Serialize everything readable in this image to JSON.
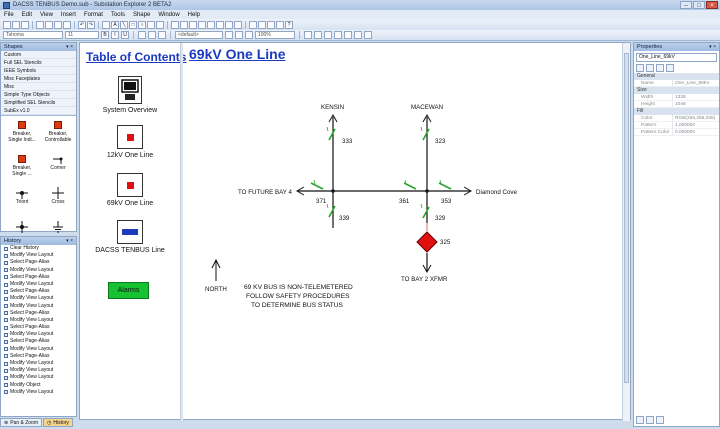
{
  "window": {
    "title": "DACSS TENBUS Demo.sub - Substation Explorer 2 BETA2"
  },
  "menu": [
    "File",
    "Edit",
    "View",
    "Insert",
    "Format",
    "Tools",
    "Shape",
    "Window",
    "Help"
  ],
  "toolbar": {
    "font": "Tahoma",
    "size": "11",
    "style_combo": "<default>",
    "zoom": "100%"
  },
  "shapes_panel": {
    "title": "Shapes",
    "stencils": [
      "Custom",
      "Full SEL Stencils",
      "IEEE Symbols",
      "Misc Faceplates",
      "Misc",
      "Simple Type Objects",
      "Simplified SEL Stencils",
      "SubEx v1.0"
    ],
    "shapes": [
      {
        "label": "Breaker, Single Indi...",
        "icon": "red-square-icon"
      },
      {
        "label": "Breaker, Controllable",
        "icon": "red-square-icon"
      },
      {
        "label": "Breaker, Single ...",
        "icon": "red-square-icon"
      },
      {
        "label": "Corner",
        "icon": "corner-icon"
      },
      {
        "label": "Triont",
        "icon": "node-icon"
      },
      {
        "label": "Cross",
        "icon": "cross-icon"
      },
      {
        "label": "",
        "icon": "node-icon"
      },
      {
        "label": "",
        "icon": "ground-icon"
      }
    ]
  },
  "history_panel": {
    "title": "History",
    "items": [
      "Clear History",
      "Modify View Layout",
      "Select Page-Alias",
      "Modify View Layout",
      "Select Page-Alias",
      "Modify View Layout",
      "Select Page-Alias",
      "Modify View Layout",
      "Modify View Layout",
      "Select Page-Alias",
      "Modify View Layout",
      "Select Page-Alias",
      "Modify View Layout",
      "Select Page-Alias",
      "Modify View Layout",
      "Select Page-Alias",
      "Modify View Layout",
      "Modify View Layout",
      "Modify View Layout",
      "Modify Object",
      "Modify View Layout"
    ]
  },
  "bottom_tabs": [
    "Pan & Zoom",
    "History"
  ],
  "nav": {
    "toc_title": "Table of Contents",
    "items": [
      "System Overview",
      "12kV One Line",
      "69kV One Line",
      "DACSS TENBUS Line"
    ],
    "alarms_label": "Alarms"
  },
  "diagram": {
    "title": "69kV One Line",
    "labels": {
      "kensin": "KENSIN",
      "macewan": "MACEWAN",
      "future_bay": "TO FUTURE BAY 4",
      "diamond_cove": "Diamond Cove",
      "bay2": "TO BAY 2 XFMR",
      "north": "NORTH"
    },
    "devices": [
      "333",
      "323",
      "371",
      "361",
      "353",
      "339",
      "329",
      "325"
    ],
    "note": [
      "69 KV BUS IS NON-TELEMETERED",
      "FOLLOW SAFETY PROCEDURES",
      "TO DETERMINE BUS STATUS"
    ],
    "colors": {
      "switch_green": "#2aa52a",
      "breaker_red": "#e01010",
      "link_blue": "#1a3ac0"
    }
  },
  "properties_panel": {
    "title": "Properties",
    "object": "One_Line_69kV",
    "categories": [
      {
        "name": "General",
        "rows": [
          {
            "key": "Name",
            "value": "One_Line_69kV"
          }
        ]
      },
      {
        "name": "Size",
        "rows": [
          {
            "key": "Width",
            "value": "1328"
          },
          {
            "key": "Height",
            "value": "1048"
          }
        ]
      },
      {
        "name": "Fill",
        "rows": [
          {
            "key": "Color",
            "value": "RGB(255,255,255)"
          },
          {
            "key": "Pattern",
            "value": "1.000000"
          },
          {
            "key": "Pattern Color",
            "value": "0.000000"
          }
        ]
      }
    ]
  }
}
